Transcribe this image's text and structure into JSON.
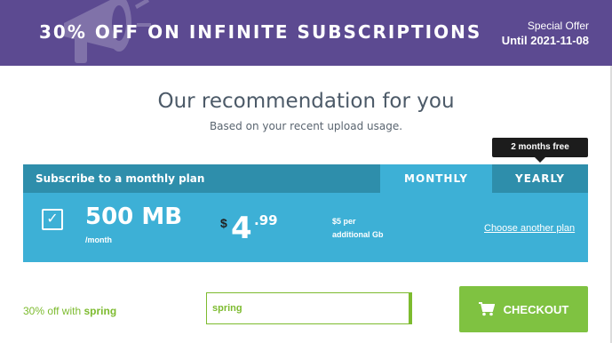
{
  "banner": {
    "title": "30% OFF ON INFINITE SUBSCRIPTIONS",
    "offer_label": "Special Offer",
    "offer_date": "Until 2021-11-08",
    "background_color": "#5c4a91",
    "decoration_icon": "megaphone-icon"
  },
  "recommendation": {
    "title": "Our recommendation for you",
    "subtitle": "Based on your recent upload usage."
  },
  "tooltip": {
    "text": "2 months free"
  },
  "plan": {
    "header_label": "Subscribe to a monthly plan",
    "tabs": [
      {
        "label": "MONTHLY",
        "selected": true
      },
      {
        "label": "YEARLY",
        "selected": false
      }
    ],
    "checked": true,
    "check_glyph": "✓",
    "size": "500 MB",
    "period": "/month",
    "price_currency": "$",
    "price_int": "4",
    "price_dec": ".99",
    "extra_line1": "$5 per",
    "extra_line2": "additional Gb",
    "choose_link": "Choose another plan",
    "color": "#3db0d6",
    "header_color": "#2e8eab"
  },
  "coupon": {
    "note_prefix": "30% off with",
    "note_code": "spring",
    "input_value": "spring",
    "accent_color": "#7dbb2f"
  },
  "checkout": {
    "label": "CHECKOUT",
    "icon": "cart-icon",
    "color": "#7fc241"
  }
}
